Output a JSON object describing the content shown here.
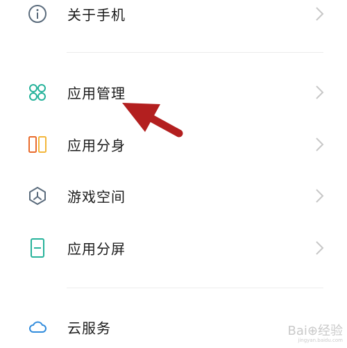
{
  "menu": {
    "items": [
      {
        "label": "关于手机",
        "icon": "info-icon"
      },
      {
        "label": "应用管理",
        "icon": "apps-grid-icon"
      },
      {
        "label": "应用分身",
        "icon": "app-clone-icon"
      },
      {
        "label": "游戏空间",
        "icon": "game-space-icon"
      },
      {
        "label": "应用分屏",
        "icon": "split-screen-icon"
      },
      {
        "label": "云服务",
        "icon": "cloud-icon"
      }
    ]
  },
  "annotation": {
    "color": "#b31f1f",
    "icon": "red-arrow-pointer"
  },
  "colors": {
    "teal": "#25b29a",
    "orange": "#e96a2b",
    "yellow": "#f3b63a",
    "slate": "#5a6b7c",
    "blue": "#2f8bdc",
    "chevron": "#c7c7c7"
  }
}
